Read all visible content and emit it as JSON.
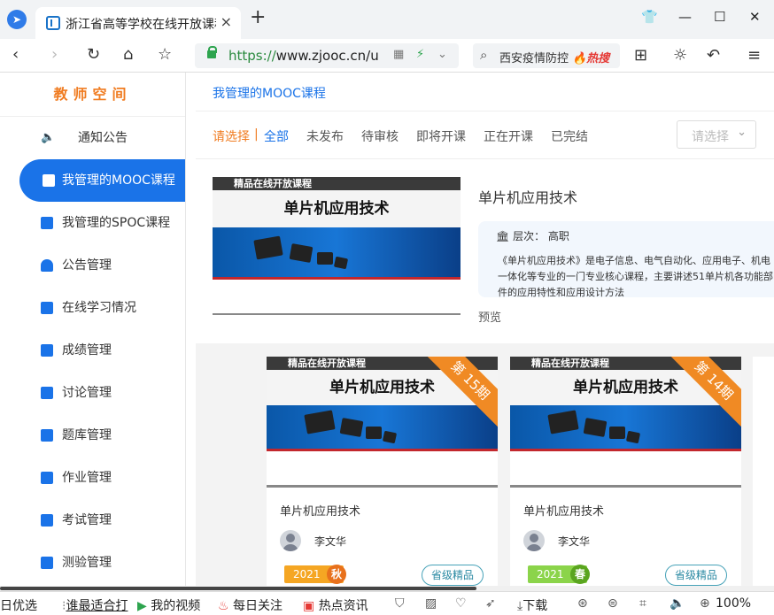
{
  "browser": {
    "tab_title": "浙江省高等学校在线开放课程共享平台",
    "tab_close": "×",
    "new_tab": "+",
    "url_scheme": "https://",
    "url_host": "www.zjooc.cn/u",
    "search_text": "西安疫情防控",
    "search_hot": "🔥热搜",
    "icons": [
      "back-icon",
      "forward-icon",
      "refresh-icon",
      "home-icon",
      "star-icon",
      "qr-icon",
      "lightning-icon",
      "chevron-down-icon",
      "apps-icon",
      "brightness-icon",
      "undo-icon",
      "menu-icon"
    ]
  },
  "sidebar": {
    "title": "教师空间",
    "items": [
      {
        "label": "通知公告"
      },
      {
        "label": "我管理的MOOC课程"
      },
      {
        "label": "我管理的SPOC课程"
      },
      {
        "label": "公告管理"
      },
      {
        "label": "在线学习情况"
      },
      {
        "label": "成绩管理"
      },
      {
        "label": "讨论管理"
      },
      {
        "label": "题库管理"
      },
      {
        "label": "作业管理"
      },
      {
        "label": "考试管理"
      },
      {
        "label": "测验管理"
      }
    ]
  },
  "main": {
    "breadcrumb": "我管理的MOOC课程",
    "filters": {
      "lead": "请选择",
      "separator": "|",
      "options": [
        "全部",
        "未发布",
        "待审核",
        "即将开课",
        "正在开课",
        "已完结"
      ],
      "select_placeholder": "请选择"
    },
    "featured": {
      "banner_header": "精品在线开放课程",
      "banner_title": "单片机应用技术",
      "title": "单片机应用技术",
      "level_label": "层次：",
      "level_value": "高职",
      "description": "《单片机应用技术》是电子信息、电气自动化、应用电子、机电一体化等专业的一门专业核心课程，主要讲述51单片机各功能部件的应用特性和应用设计方法",
      "preview_label": "预览"
    },
    "cards": [
      {
        "banner_header": "精品在线开放课程",
        "banner_title": "单片机应用技术",
        "period": "第 15期",
        "name": "单片机应用技术",
        "teacher": "李文华",
        "year": "2021",
        "season": "秋",
        "grade": "省级精品",
        "tag_color": "#f5a623",
        "season_color": "#e8711c"
      },
      {
        "banner_header": "精品在线开放课程",
        "banner_title": "单片机应用技术",
        "period": "第 14期",
        "name": "单片机应用技术",
        "teacher": "李文华",
        "year": "2021",
        "season": "春",
        "grade": "省级精品",
        "tag_color": "#8bd44a",
        "season_color": "#5aa51f"
      }
    ]
  },
  "statusbar": {
    "items": [
      "日优选",
      "谁最适合打",
      "我的视频",
      "每日关注",
      "热点资讯",
      "下载",
      "100%"
    ]
  },
  "colors": {
    "accent": "#1a73e8",
    "sidebar_title": "#f07c21",
    "ribbon": "#f08a24"
  }
}
